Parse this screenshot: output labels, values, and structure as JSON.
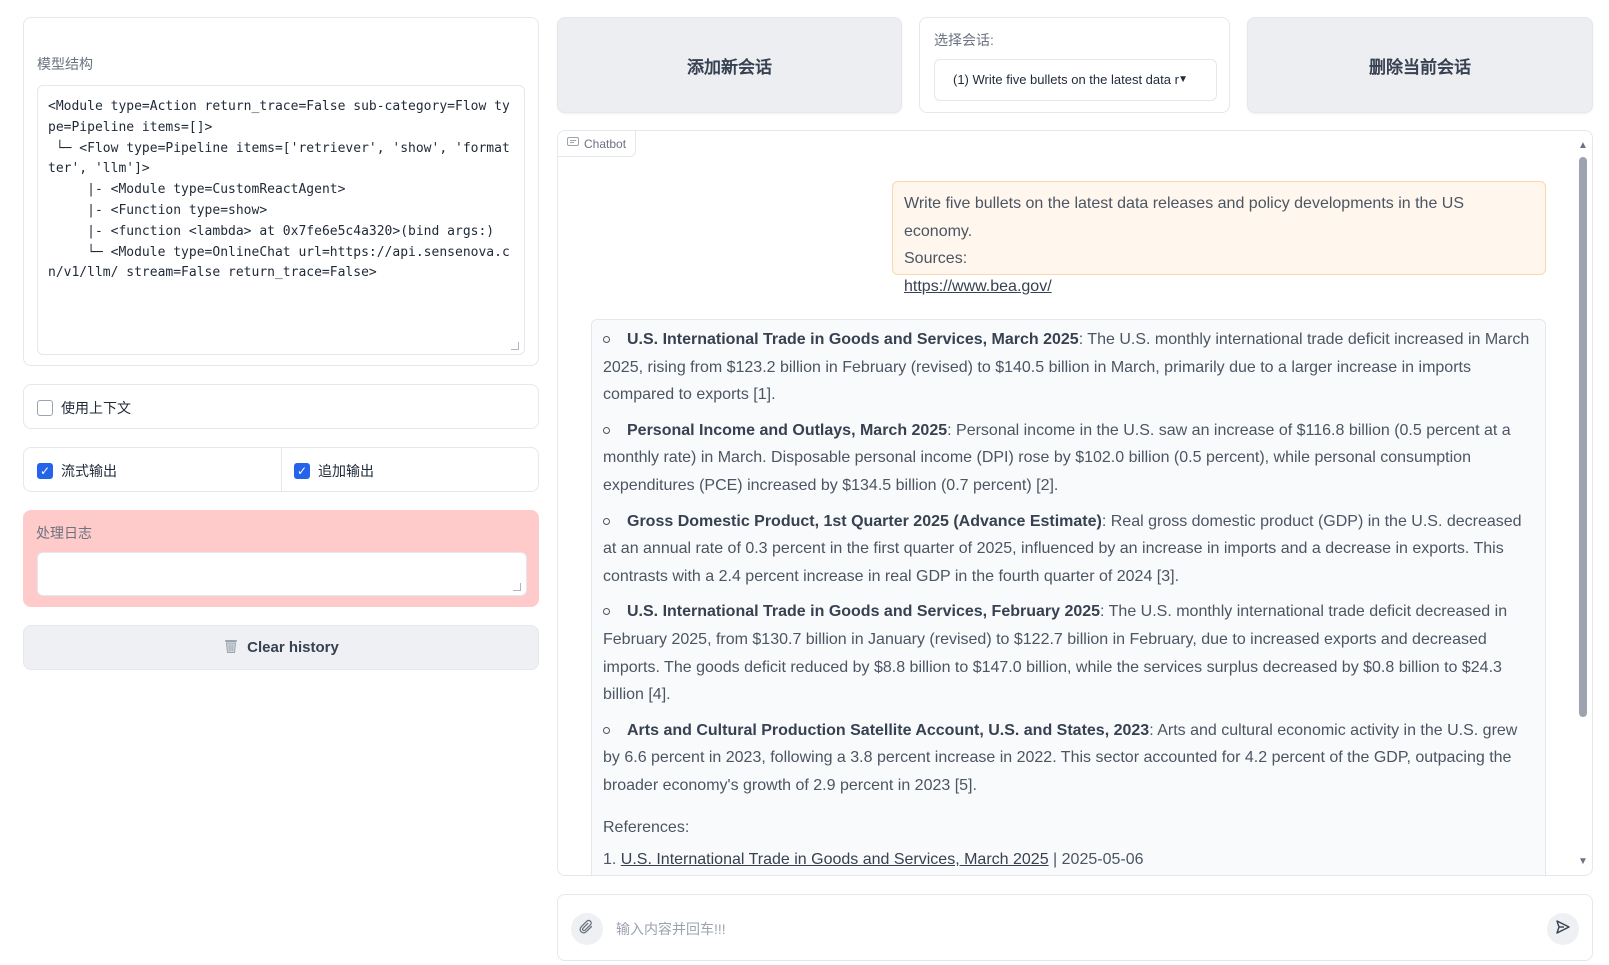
{
  "model_structure": {
    "label": "模型结构",
    "code": "<Module type=Action return_trace=False sub-category=Flow type=Pipeline items=[]>\n └─ <Flow type=Pipeline items=['retriever', 'show', 'formatter', 'llm']>\n     |- <Module type=CustomReactAgent>\n     |- <Function type=show>\n     |- <function <lambda> at 0x7fe6e5c4a320>(bind args:)\n     └─ <Module type=OnlineChat url=https://api.sensenova.cn/v1/llm/ stream=False return_trace=False>"
  },
  "options": {
    "use_context": {
      "label": "使用上下文",
      "checked": false
    },
    "stream_output": {
      "label": "流式输出",
      "checked": true
    },
    "append_output": {
      "label": "追加输出",
      "checked": true
    }
  },
  "log": {
    "label": "处理日志",
    "value": ""
  },
  "clear_history_label": "Clear history",
  "top_buttons": {
    "add_session": "添加新会话",
    "delete_session": "删除当前会话"
  },
  "session": {
    "label": "选择会话:",
    "selected": "(1)  Write five bullets on  the latest data r"
  },
  "chatbot": {
    "tag_label": "Chatbot",
    "user_message": {
      "line1": "Write five bullets on the latest data releases and policy developments in the US economy.",
      "line2": "Sources:",
      "link": "https://www.bea.gov/"
    },
    "bullets": [
      {
        "title": "U.S. International Trade in Goods and Services, March 2025",
        "text": ": The U.S. monthly international trade deficit increased in March 2025, rising from $123.2 billion in February (revised) to $140.5 billion in March, primarily due to a larger increase in imports compared to exports [1]."
      },
      {
        "title": "Personal Income and Outlays, March 2025",
        "text": ": Personal income in the U.S. saw an increase of $116.8 billion (0.5 percent at a monthly rate) in March. Disposable personal income (DPI) rose by $102.0 billion (0.5 percent), while personal consumption expenditures (PCE) increased by $134.5 billion (0.7 percent) [2]."
      },
      {
        "title": "Gross Domestic Product, 1st Quarter 2025 (Advance Estimate)",
        "text": ": Real gross domestic product (GDP) in the U.S. decreased at an annual rate of 0.3 percent in the first quarter of 2025, influenced by an increase in imports and a decrease in exports. This contrasts with a 2.4 percent increase in real GDP in the fourth quarter of 2024 [3]."
      },
      {
        "title": "U.S. International Trade in Goods and Services, February 2025",
        "text": ": The U.S. monthly international trade deficit decreased in February 2025, from $130.7 billion in January (revised) to $122.7 billion in February, due to increased exports and decreased imports. The goods deficit reduced by $8.8 billion to $147.0 billion, while the services surplus decreased by $0.8 billion to $24.3 billion [4]."
      },
      {
        "title": "Arts and Cultural Production Satellite Account, U.S. and States, 2023",
        "text": ": Arts and cultural economic activity in the U.S. grew by 6.6 percent in 2023, following a 3.8 percent increase in 2022. This sector accounted for 4.2 percent of the GDP, outpacing the broader economy's growth of 2.9 percent in 2023 [5]."
      }
    ],
    "references_title": "References:",
    "reference_1": {
      "num": "1.",
      "link": "U.S. International Trade in Goods and Services, March 2025",
      "date": " | 2025-05-06"
    }
  },
  "input": {
    "placeholder": "输入内容并回车!!!"
  }
}
